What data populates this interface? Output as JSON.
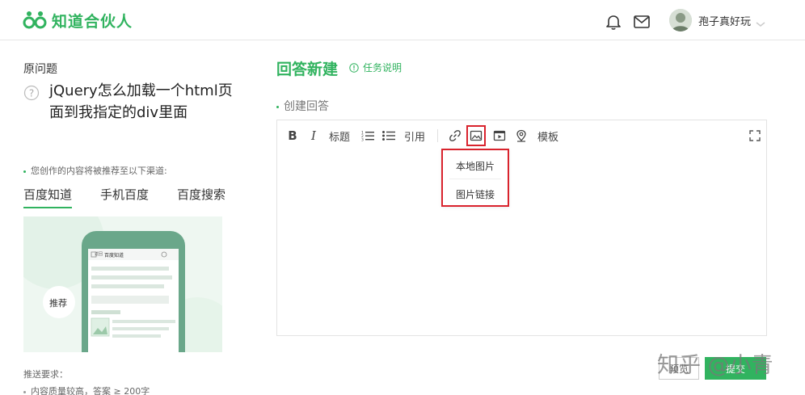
{
  "header": {
    "logo_text": "知道合伙人",
    "username": "孢子真好玩",
    "icons": [
      "logo-mark-icon",
      "bell-icon",
      "mail-icon",
      "avatar",
      "chevron-down-icon"
    ]
  },
  "left": {
    "original_label": "原问题",
    "question": "jQuery怎么加载一个html页面到我指定的div里面",
    "recommend_note": "您创作的内容将被推荐至以下渠道:",
    "channels": [
      {
        "label": "百度知道",
        "active": true
      },
      {
        "label": "手机百度",
        "active": false
      },
      {
        "label": "百度搜索",
        "active": false
      }
    ],
    "illustration": {
      "phone_header": "百度知道",
      "phone_left_tab": "返回",
      "badge": "推荐"
    },
    "requirements_title": "推送要求：",
    "requirements": [
      "内容质量较高，答案 ≥ 200字"
    ]
  },
  "main": {
    "title": "回答新建",
    "task_link": "任务说明",
    "create_label": "创建回答",
    "toolbar": {
      "bold": "B",
      "italic": "I",
      "heading": "标题",
      "quote": "引用",
      "template": "模板"
    },
    "image_menu": {
      "items": [
        "本地图片",
        "图片链接"
      ]
    },
    "buttons": {
      "save": "预览",
      "submit": "提交"
    }
  },
  "watermark": "知乎 @小青",
  "colors": {
    "accent": "#31b35f",
    "highlight": "#d9232d"
  }
}
